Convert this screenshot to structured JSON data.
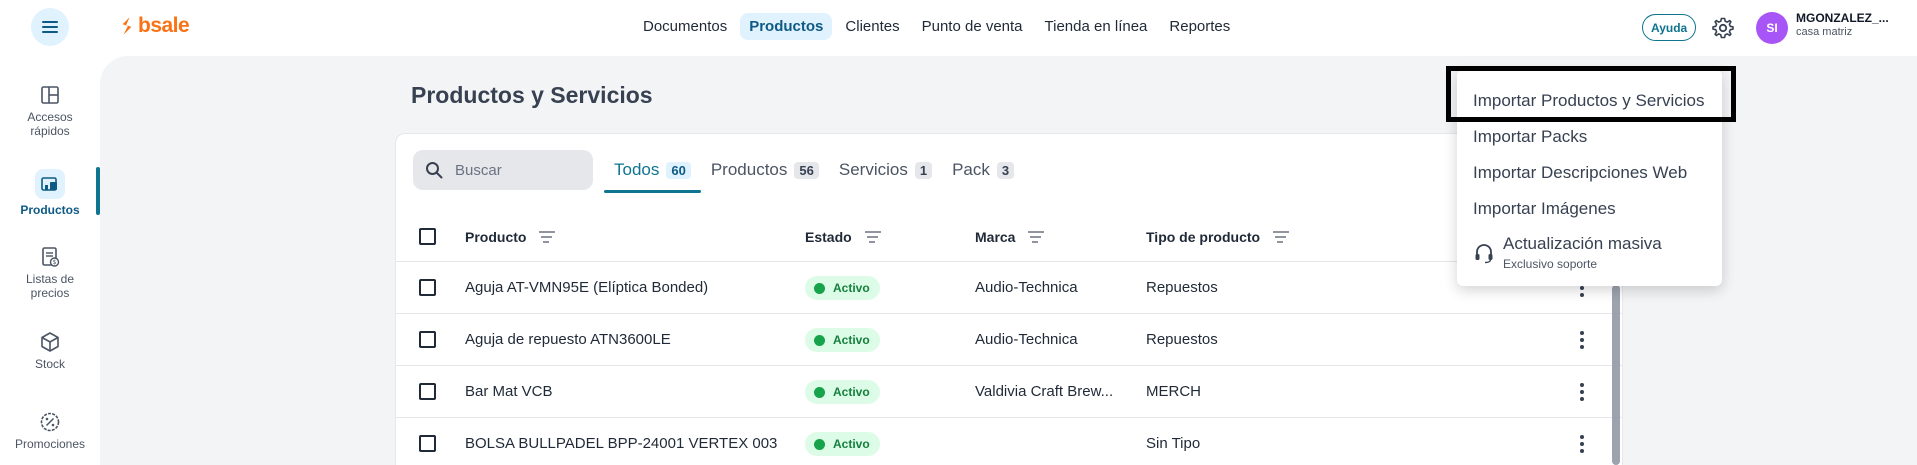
{
  "brand": {
    "name": "bsale",
    "accent": "#f97316"
  },
  "topnav": {
    "items": [
      {
        "label": "Documentos",
        "active": false
      },
      {
        "label": "Productos",
        "active": true
      },
      {
        "label": "Clientes",
        "active": false
      },
      {
        "label": "Punto de venta",
        "active": false
      },
      {
        "label": "Tienda en línea",
        "active": false
      },
      {
        "label": "Reportes",
        "active": false
      }
    ],
    "help_label": "Ayuda"
  },
  "user": {
    "initials": "SI",
    "name": "MGONZALEZ_...",
    "branch": "casa matriz"
  },
  "sidebar": {
    "items": [
      {
        "label": "Accesos rápidos",
        "icon": "layout-icon"
      },
      {
        "label": "Productos",
        "icon": "products-icon",
        "active": true
      },
      {
        "label": "Listas de precios",
        "icon": "price-list-icon"
      },
      {
        "label": "Stock",
        "icon": "cube-icon"
      },
      {
        "label": "Promociones",
        "icon": "percent-badge-icon"
      }
    ]
  },
  "page": {
    "title": "Productos y Servicios"
  },
  "search": {
    "placeholder": "Buscar",
    "value": ""
  },
  "tabs": [
    {
      "label": "Todos",
      "count": "60",
      "active": true
    },
    {
      "label": "Productos",
      "count": "56"
    },
    {
      "label": "Servicios",
      "count": "1"
    },
    {
      "label": "Pack",
      "count": "3"
    }
  ],
  "table": {
    "columns": [
      "Producto",
      "Estado",
      "Marca",
      "Tipo de producto"
    ],
    "rows": [
      {
        "producto": "Aguja AT-VMN95E (Elíptica Bonded)",
        "estado": "Activo",
        "marca": "Audio-Technica",
        "tipo": "Repuestos"
      },
      {
        "producto": "Aguja de repuesto ATN3600LE",
        "estado": "Activo",
        "marca": "Audio-Technica",
        "tipo": "Repuestos"
      },
      {
        "producto": "Bar Mat VCB",
        "estado": "Activo",
        "marca": "Valdivia Craft Brew...",
        "tipo": "MERCH"
      },
      {
        "producto": "BOLSA BULLPADEL BPP-24001 VERTEX 003",
        "estado": "Activo",
        "marca": "",
        "tipo": "Sin Tipo"
      }
    ]
  },
  "dropdown": {
    "items": [
      "Importar Productos y Servicios",
      "Importar Packs",
      "Importar Descripciones Web",
      "Importar Imágenes"
    ],
    "bulk_update": {
      "label": "Actualización masiva",
      "sublabel": "Exclusivo soporte",
      "icon": "headset-icon"
    }
  }
}
